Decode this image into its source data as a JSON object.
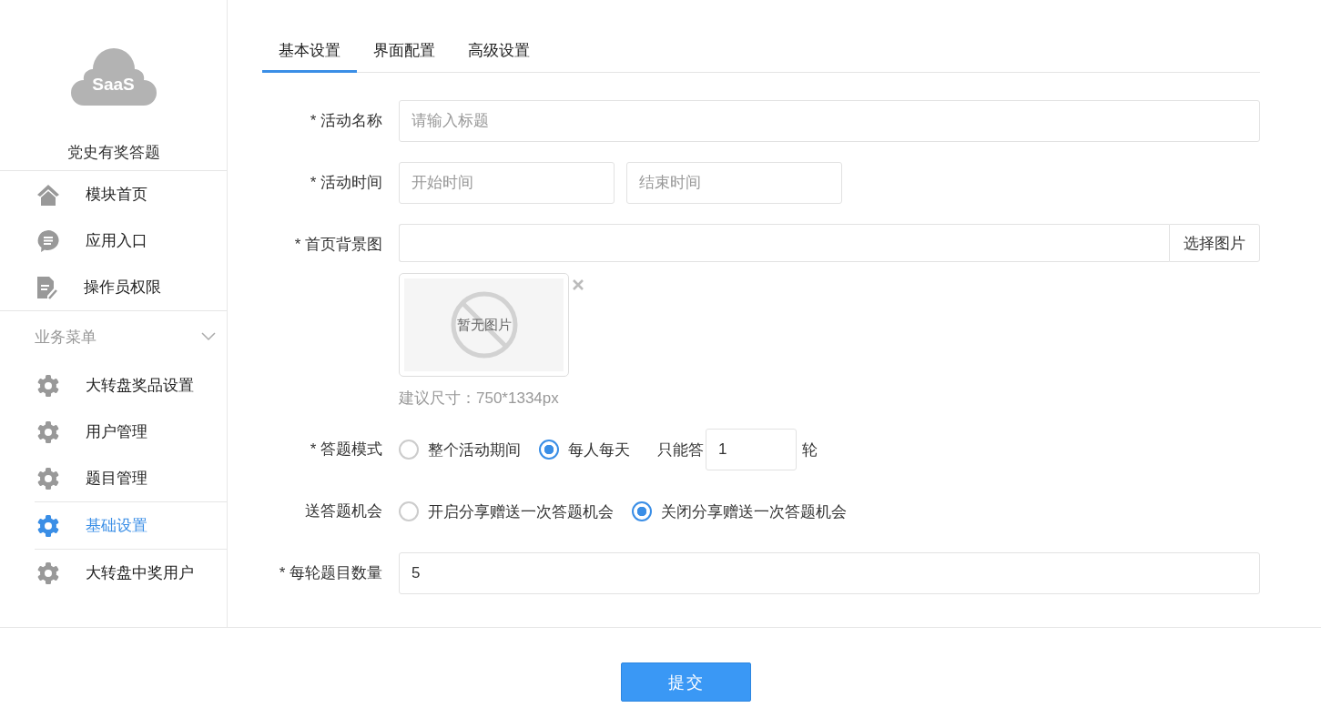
{
  "sidebar": {
    "logo_text": "SaaS",
    "app_title": "党史有奖答题",
    "items": [
      {
        "label": "模块首页",
        "kind": "home"
      },
      {
        "label": "应用入口",
        "kind": "chat"
      },
      {
        "label": "操作员权限",
        "kind": "doc"
      }
    ],
    "group": {
      "label": "业务菜单",
      "expanded": true,
      "items": [
        {
          "label": "大转盘奖品设置",
          "selected": false
        },
        {
          "label": "用户管理",
          "selected": false
        },
        {
          "label": "题目管理",
          "selected": false
        },
        {
          "label": "基础设置",
          "selected": true
        },
        {
          "label": "大转盘中奖用户",
          "selected": false
        }
      ]
    }
  },
  "tabs": [
    {
      "label": "基本设置",
      "selected": true
    },
    {
      "label": "界面配置",
      "selected": false
    },
    {
      "label": "高级设置",
      "selected": false
    }
  ],
  "form": [
    {
      "kind": "text",
      "label": "* 活动名称",
      "placeholder": "请输入标题"
    },
    {
      "kind": "range",
      "label": "* 活动时间",
      "start_placeholder": "开始时间",
      "end_placeholder": "结束时间"
    },
    {
      "kind": "image",
      "label": "* 首页背景图",
      "button": "选择图片",
      "preview_text": "暂无图片",
      "hint": "建议尺寸：750*1334px"
    },
    {
      "kind": "radio",
      "label": "* 答题模式",
      "options": [
        {
          "label": "整个活动期间",
          "selected": false
        },
        {
          "label": "每人每天",
          "selected": true
        }
      ],
      "prefix": "只能答",
      "value": "1",
      "suffix": "轮"
    },
    {
      "kind": "radio",
      "label": "送答题机会",
      "options": [
        {
          "label": "开启分享赠送一次答题机会",
          "selected": false
        },
        {
          "label": "关闭分享赠送一次答题机会",
          "selected": true
        }
      ]
    },
    {
      "kind": "text",
      "label": "* 每轮题目数量",
      "value": "5"
    }
  ],
  "submit": "提交"
}
